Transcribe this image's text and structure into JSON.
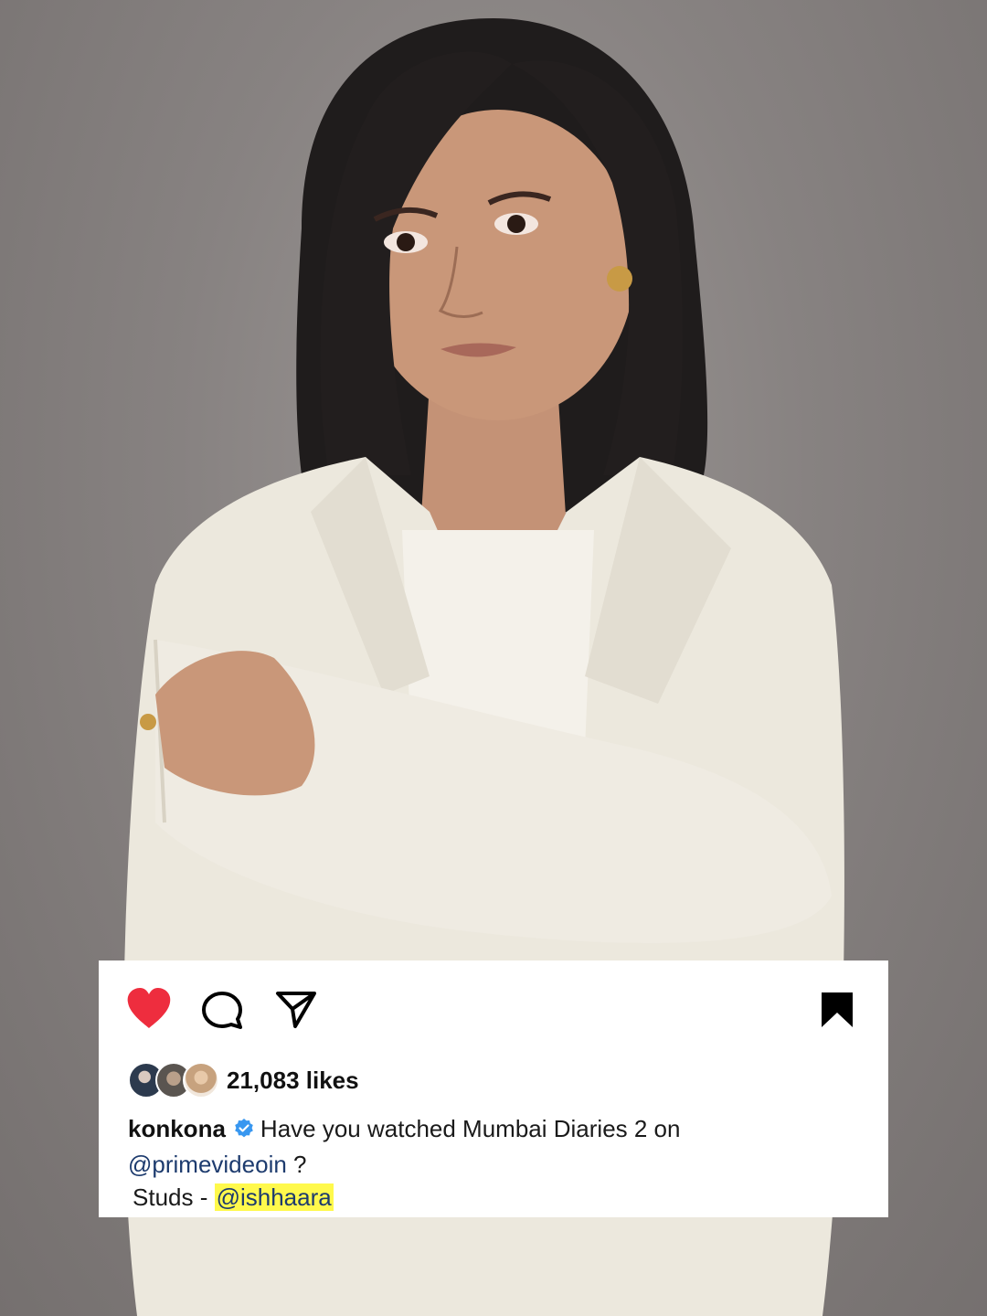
{
  "photo": {
    "description_icon": "portrait-photo"
  },
  "post": {
    "actions": {
      "like_icon": "heart-filled-icon",
      "comment_icon": "comment-icon",
      "share_icon": "send-icon",
      "save_icon": "bookmark-filled-icon"
    },
    "likes_count": "21,083 likes",
    "caption": {
      "username": "konkona",
      "verified": true,
      "text_part1": "Have you watched Mumbai Diaries 2 on",
      "mention1": "@primevideoin",
      "text_part2": " ?",
      "studs_label": "Studs - ",
      "mention2": "@ishhaara"
    }
  },
  "colors": {
    "heart": "#ee2d3e",
    "verified": "#3897f0",
    "mention": "#1d3b6e",
    "highlight": "#fff94c"
  }
}
